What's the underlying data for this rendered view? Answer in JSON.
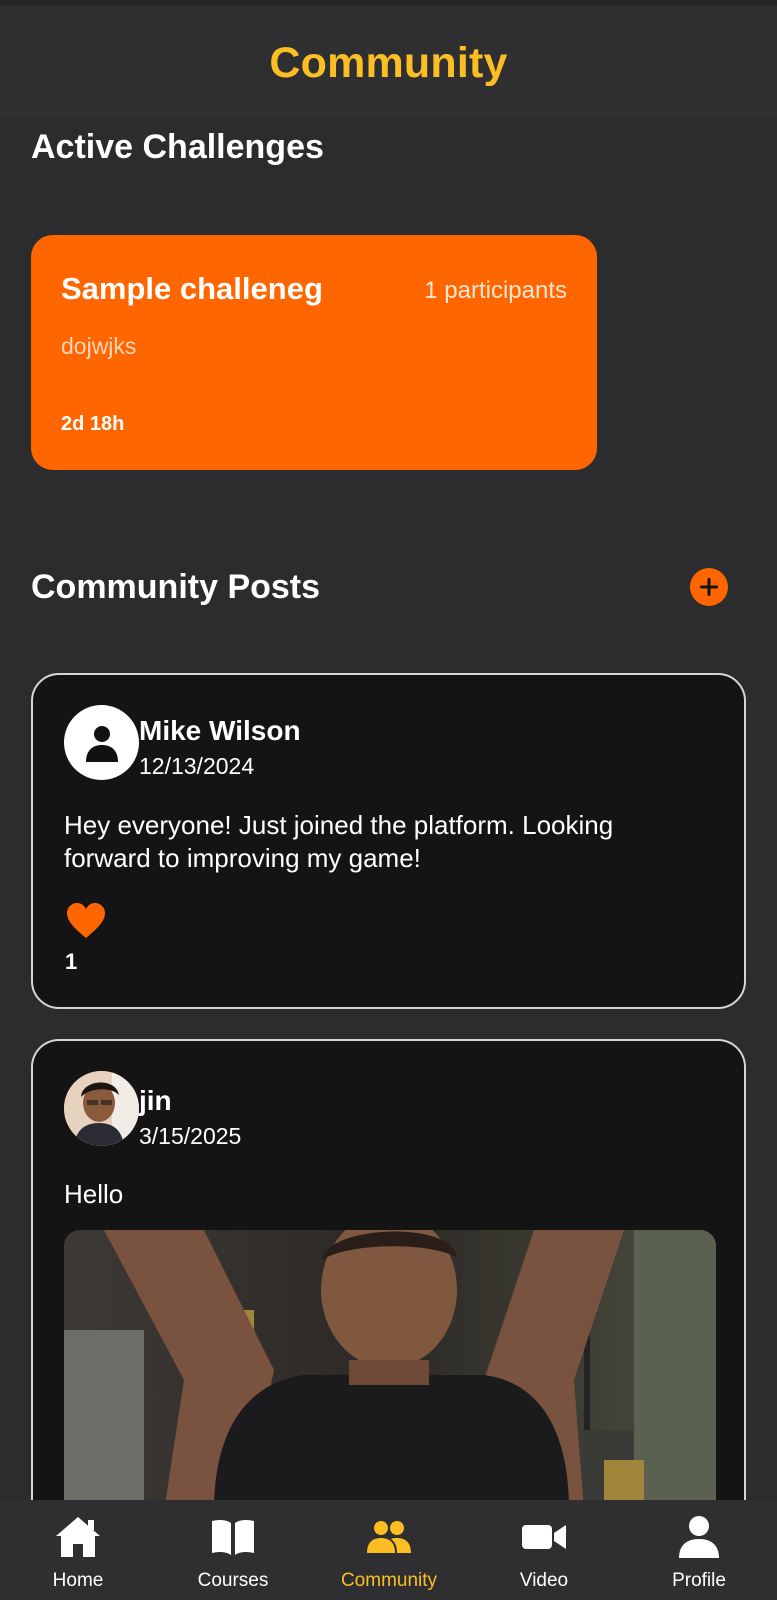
{
  "header": {
    "title": "Community"
  },
  "challenges": {
    "section_title": "Active Challenges",
    "items": [
      {
        "name": "Sample challeneg",
        "participants": "1 participants",
        "description": "dojwjks",
        "time_left": "2d 18h"
      }
    ]
  },
  "posts": {
    "section_title": "Community Posts",
    "add_icon": "plus-icon",
    "items": [
      {
        "author": "Mike Wilson",
        "date": "12/13/2024",
        "text": "Hey everyone! Just joined the platform. Looking forward to improving my game!",
        "likes": "1",
        "avatar": "default-user-icon"
      },
      {
        "author": "jin",
        "date": "3/15/2025",
        "text": "Hello",
        "avatar": "user-photo"
      }
    ]
  },
  "nav": {
    "items": [
      {
        "label": "Home",
        "icon": "home-icon"
      },
      {
        "label": "Courses",
        "icon": "book-icon"
      },
      {
        "label": "Community",
        "icon": "users-icon",
        "active": true
      },
      {
        "label": "Video",
        "icon": "video-camera-icon"
      },
      {
        "label": "Profile",
        "icon": "user-icon"
      }
    ]
  },
  "colors": {
    "accent": "#ff6600",
    "title_yellow": "#fbbf24",
    "background": "#2c2c2e",
    "card_background": "#141414"
  }
}
